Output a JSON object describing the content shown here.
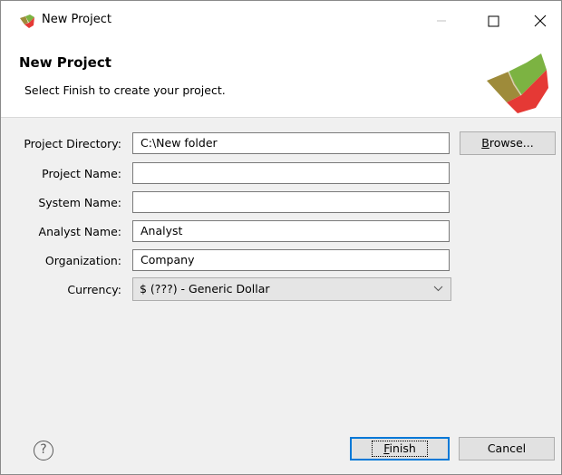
{
  "window": {
    "title": "New Project",
    "icon": "app-logo-icon"
  },
  "header": {
    "title": "New Project",
    "subtitle": "Select Finish to create your project."
  },
  "form": {
    "project_directory": {
      "label": "Project Directory:",
      "value": "C:\\New folder"
    },
    "project_name": {
      "label": "Project Name:",
      "value": ""
    },
    "system_name": {
      "label": "System Name:",
      "value": ""
    },
    "analyst_name": {
      "label": "Analyst Name:",
      "value": "Analyst"
    },
    "organization": {
      "label": "Organization:",
      "value": "Company"
    },
    "currency": {
      "label": "Currency:",
      "value": "$ (???) - Generic Dollar"
    }
  },
  "buttons": {
    "browse_prefix": "",
    "browse_mnemonic": "B",
    "browse_rest": "rowse...",
    "finish_mnemonic": "F",
    "finish_rest": "inish",
    "cancel": "Cancel",
    "help": "?"
  },
  "colors": {
    "focus_border": "#0078d7",
    "logo_green": "#7cb342",
    "logo_red": "#e53935",
    "logo_olive": "#9e8b3a"
  }
}
